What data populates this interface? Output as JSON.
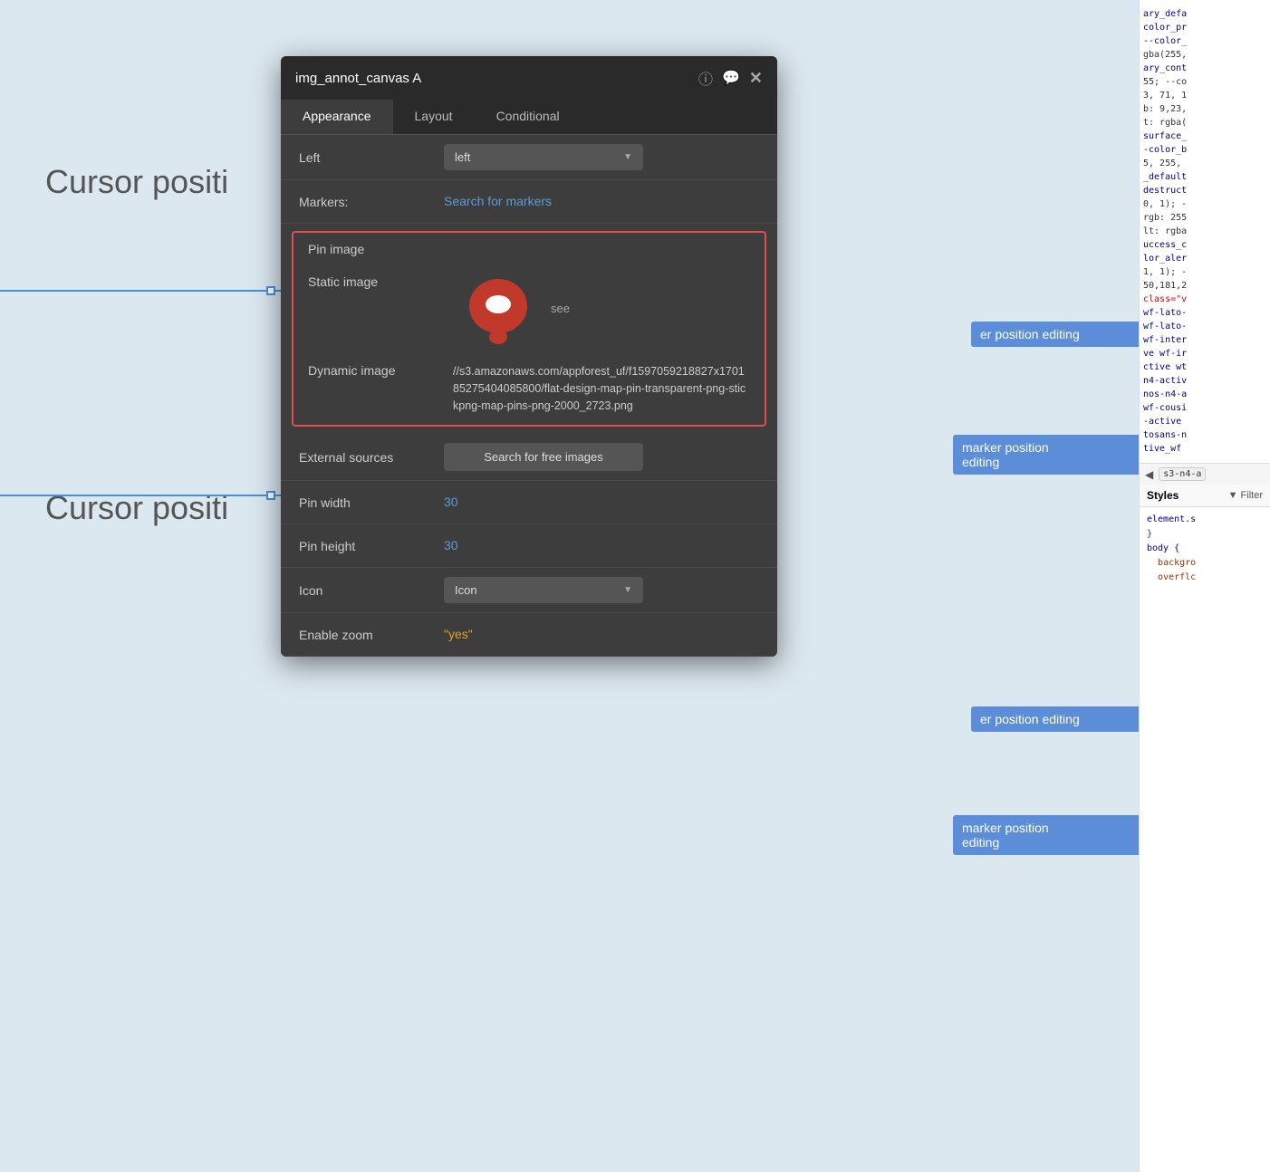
{
  "canvas": {
    "cursor_text_1": "Cursor positi",
    "cursor_text_2": "Cursor positi"
  },
  "blue_rows": [
    "er position editing",
    "marker position editing",
    "er position editing",
    "marker position editing"
  ],
  "devtools": {
    "code_lines": [
      "ary_defa",
      "color_pr",
      "--color_",
      "gba(255,",
      "ary_cont",
      "55; --co",
      "3, 71, 1",
      "b: 9,23,",
      "t: rgba(",
      "surface_",
      "-color_b",
      "5, 255,",
      "_default",
      "destruct",
      "0, 1); -",
      "rgb: 255",
      "lt: rgba",
      "uccess_c",
      "lor_aler",
      "1, 1); -",
      "50,181,2",
      "class=\"v",
      "wf-lato-",
      "wf-lato-",
      "wf-inter",
      "ve wf-ir",
      "ctive wt",
      "n4-activ",
      "nos-n4-a",
      "wf-cousi",
      "-active",
      "tosans-n",
      "tive_wf"
    ],
    "class_badge": "s3-n4-a",
    "styles_title": "Styles",
    "filter_label": "Filter",
    "element_selector": "element.s",
    "body_selector": "body {",
    "body_prop1": "backgro",
    "body_prop2": "overflc"
  },
  "modal": {
    "title": "img_annot_canvas A",
    "tabs": [
      {
        "label": "Appearance",
        "active": true
      },
      {
        "label": "Layout",
        "active": false
      },
      {
        "label": "Conditional",
        "active": false
      }
    ],
    "fields": {
      "left_label": "Left",
      "left_value": "left",
      "markers_label": "Markers:",
      "markers_placeholder": "Search for markers",
      "pin_image_label": "Pin image",
      "static_image_label": "Static image",
      "see_link": "see",
      "dynamic_image_label": "Dynamic image",
      "dynamic_url": "//s3.amazonaws.com/appforest_uf/f1597059218827x170185275404085800/flat-design-map-pin-transparent-png-stickpng-map-pins-png-2000_2723.png",
      "external_sources_label": "External sources",
      "external_sources_btn": "Search for free images",
      "pin_width_label": "Pin width",
      "pin_width_value": "30",
      "pin_height_label": "Pin height",
      "pin_height_value": "30",
      "icon_label": "Icon",
      "icon_value": "Icon",
      "enable_zoom_label": "Enable zoom",
      "enable_zoom_value": "\"yes\""
    }
  }
}
